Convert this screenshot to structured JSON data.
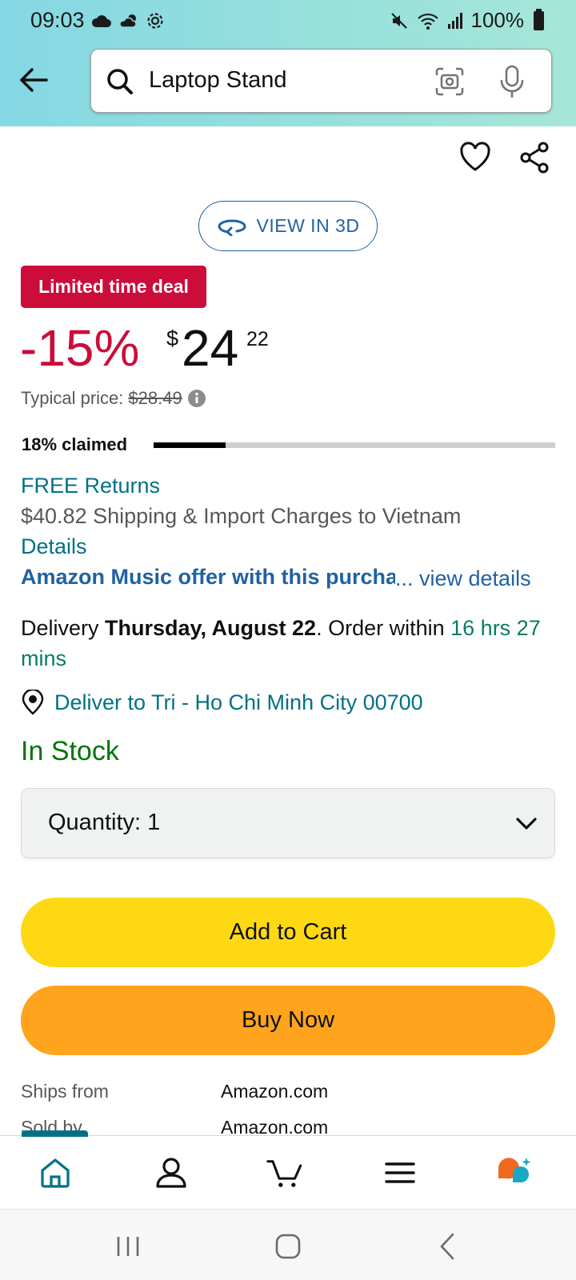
{
  "status_bar": {
    "time": "09:03",
    "battery": "100%"
  },
  "search": {
    "query": "Laptop Stand"
  },
  "product": {
    "view_3d_label": "VIEW IN 3D",
    "deal_badge": "Limited time deal",
    "discount": "-15%",
    "price_symbol": "$",
    "price_whole": "24",
    "price_fraction": "22",
    "typical_price_label": "Typical price:",
    "typical_price_value": "$28.49",
    "claimed_label": "18% claimed",
    "claimed_fraction": 0.18,
    "free_returns": "FREE Returns",
    "shipping": "$40.82 Shipping & Import Charges to Vietnam",
    "details_link": "Details",
    "music_offer": "Amazon Music offer with this purchase",
    "view_details": "... view details",
    "delivery_prefix": "Delivery ",
    "delivery_date": "Thursday, August 22",
    "delivery_mid": ". Order within ",
    "delivery_countdown": "16 hrs 27 mins",
    "deliver_to": "Deliver to Tri - Ho Chi Minh City 00700",
    "stock_status": "In Stock",
    "quantity_label": "Quantity:",
    "quantity_value": "1",
    "add_to_cart": "Add to Cart",
    "buy_now": "Buy Now",
    "ships_from_label": "Ships from",
    "ships_from_value": "Amazon.com",
    "sold_by_label": "Sold by",
    "sold_by_value": "Amazon.com"
  },
  "bottom_nav": {
    "items": [
      "home-icon",
      "account-icon",
      "cart-icon",
      "menu-icon",
      "rufus-icon"
    ]
  },
  "colors": {
    "deal_red": "#cc0c39",
    "link_teal": "#007185",
    "link_blue": "#2162a1",
    "in_stock_green": "#007600",
    "cart_yellow": "#ffd814",
    "buy_orange": "#ffa41c"
  }
}
